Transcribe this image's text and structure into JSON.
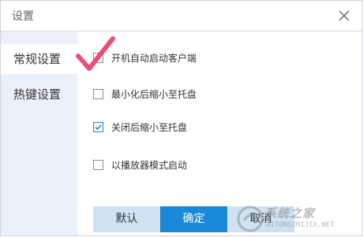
{
  "window": {
    "title": "设置"
  },
  "sidebar": {
    "items": [
      {
        "label": "常规设置",
        "active": true
      },
      {
        "label": "热键设置",
        "active": false
      }
    ]
  },
  "options": [
    {
      "label": "开机自动启动客户端",
      "checked": false
    },
    {
      "label": "最小化后缩小至托盘",
      "checked": false
    },
    {
      "label": "关闭后缩小至托盘",
      "checked": true
    },
    {
      "label": "以播放器模式启动",
      "checked": false
    }
  ],
  "buttons": {
    "default_label": "默认",
    "ok_label": "确定",
    "cancel_label": "取消"
  },
  "watermark": {
    "text": "系统之家",
    "url": "XITONGZHIJIA.NET"
  },
  "colors": {
    "accent": "#1a8ad8",
    "sidebar_bg": "#e9f1f9",
    "annotation": "#e8507a"
  }
}
